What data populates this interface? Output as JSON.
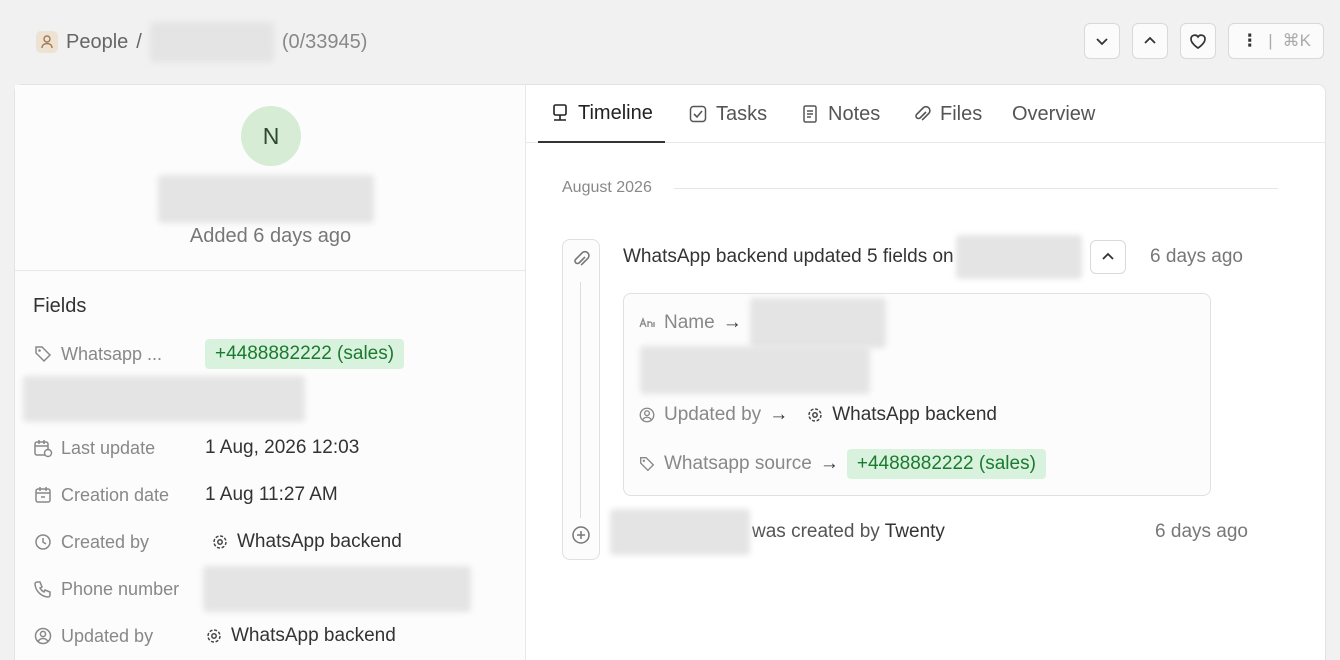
{
  "breadcrumb": {
    "section": "People",
    "separator": "/",
    "count": "(0/33945)"
  },
  "top_actions": {
    "menu_shortcut": "⌘K",
    "menu_divider": "|"
  },
  "profile": {
    "avatar_initial": "N",
    "added": "Added 6 days ago"
  },
  "fields": {
    "title": "Fields",
    "whatsapp_label": "Whatsapp ...",
    "whatsapp_value": "+4488882222 (sales)",
    "last_update_label": "Last update",
    "last_update_value": "1 Aug, 2026 12:03",
    "creation_date_label": "Creation date",
    "creation_date_value": "1 Aug 11:27 AM",
    "created_by_label": "Created by",
    "created_by_value": "WhatsApp backend",
    "phone_label": "Phone number",
    "updated_by_label": "Updated by",
    "updated_by_value": "WhatsApp backend"
  },
  "tabs": [
    {
      "label": "Timeline",
      "icon": "timeline-icon"
    },
    {
      "label": "Tasks",
      "icon": "checkbox-icon"
    },
    {
      "label": "Notes",
      "icon": "note-icon"
    },
    {
      "label": "Files",
      "icon": "paperclip-icon"
    },
    {
      "label": "Overview",
      "icon": ""
    }
  ],
  "timeline": {
    "month": "August 2026",
    "event1": {
      "text": "WhatsApp backend updated 5 fields on",
      "time": "6 days ago",
      "diffs": {
        "name_label": "Name",
        "arrow": "→",
        "updated_by_label": "Updated by",
        "updated_by_value": "WhatsApp backend",
        "whatsapp_label": "Whatsapp source",
        "whatsapp_value": "+4488882222 (sales)"
      }
    },
    "event2": {
      "text": "was created by",
      "actor": "Twenty",
      "time": "6 days ago"
    }
  }
}
